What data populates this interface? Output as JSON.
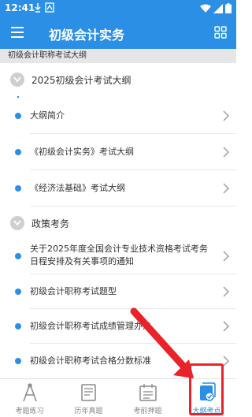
{
  "status_bar": {
    "time": "12:41"
  },
  "app_bar": {
    "title": "初级会计实务"
  },
  "section_header": "初级会计职称考试大纲",
  "groups": [
    {
      "title": "2025初级会计考试大纲",
      "items": [
        "大纲简介",
        "《初级会计实务》考试大纲",
        "《经济法基础》考试大纲"
      ]
    },
    {
      "title": "政策考务",
      "items": [
        "关于2025年度全国会计专业技术资格考试考务日程安排及有关事项的通知",
        "初级会计职称考试题型",
        "初级会计职称考试成绩管理办法",
        "初级会计职称考试合格分数标准"
      ]
    }
  ],
  "bottom_nav": [
    {
      "label": "考题练习",
      "icon": "compass-icon",
      "active": false
    },
    {
      "label": "历年真题",
      "icon": "document-icon",
      "active": false
    },
    {
      "label": "考前押题",
      "icon": "calendar-icon",
      "active": false
    },
    {
      "label": "大纲考点",
      "icon": "outline-badge-icon",
      "active": true
    }
  ],
  "colors": {
    "primary": "#2b8fe6",
    "highlight": "#e8232a"
  }
}
